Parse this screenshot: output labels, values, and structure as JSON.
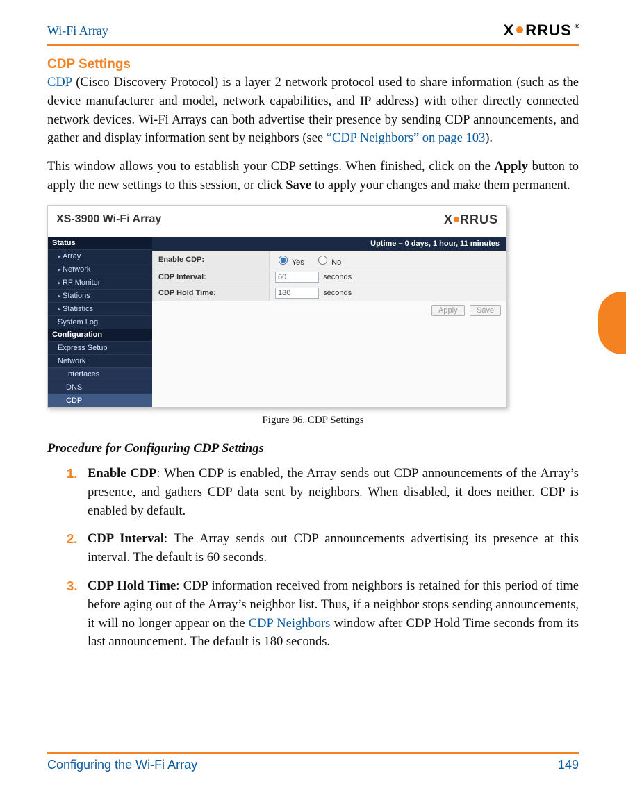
{
  "header": {
    "doc_title": "Wi-Fi Array",
    "brand_left": "X",
    "brand_right": "RRUS",
    "brand_reg": "®"
  },
  "section": {
    "heading": "CDP Settings",
    "p1_lead_link": "CDP",
    "p1_rest_a": " (Cisco Discovery Protocol) is a layer 2 network protocol used to share information (such as the device manufacturer and model, network capabilities, and IP address) with other directly connected network devices. Wi-Fi Arrays can both advertise their presence by sending CDP announcements, and gather and display information sent by neighbors (see ",
    "p1_link2": "“CDP Neighbors” on page 103",
    "p1_rest_b": ").",
    "p2_a": "This window allows you to establish your CDP settings. When finished, click on the ",
    "p2_apply": "Apply",
    "p2_b": " button to apply the new settings to this session, or click ",
    "p2_save": "Save",
    "p2_c": " to apply your changes and make them permanent."
  },
  "figure": {
    "window_title": "XS-3900 Wi-Fi Array",
    "uptime": "Uptime – 0 days, 1 hour, 11 minutes",
    "nav_status": "Status",
    "nav_items": [
      "Array",
      "Network",
      "RF Monitor",
      "Stations",
      "Statistics",
      "System Log"
    ],
    "nav_config": "Configuration",
    "nav_config_items": [
      "Express Setup",
      "Network"
    ],
    "nav_sub": [
      "Interfaces",
      "DNS",
      "CDP"
    ],
    "row1_label": "Enable CDP:",
    "row1_yes": "Yes",
    "row1_no": "No",
    "row2_label": "CDP Interval:",
    "row2_value": "60",
    "row2_unit": "seconds",
    "row3_label": "CDP Hold Time:",
    "row3_value": "180",
    "row3_unit": "seconds",
    "btn_apply": "Apply",
    "btn_save": "Save",
    "caption": "Figure 96. CDP Settings"
  },
  "procedure": {
    "heading": "Procedure for Configuring CDP Settings",
    "steps": [
      {
        "bold": "Enable CDP",
        "text": ": When CDP is enabled, the Array sends out CDP announcements of the Array’s presence, and gathers CDP data sent by neighbors. When disabled, it does neither. CDP is enabled by default."
      },
      {
        "bold": "CDP Interval",
        "text": ": The Array sends out CDP announcements advertising its presence at this interval. The default is 60 seconds."
      },
      {
        "bold": "CDP Hold Time",
        "text_a": ": CDP information received from neighbors is retained for this period of time before aging out of the Array’s neighbor list. Thus, if a neighbor stops sending announcements, it will no longer appear on the ",
        "link": "CDP Neighbors",
        "text_b": " window after CDP Hold Time seconds from its last announcement. The default is 180 seconds."
      }
    ]
  },
  "footer": {
    "left": "Configuring the Wi-Fi Array",
    "right": "149"
  }
}
